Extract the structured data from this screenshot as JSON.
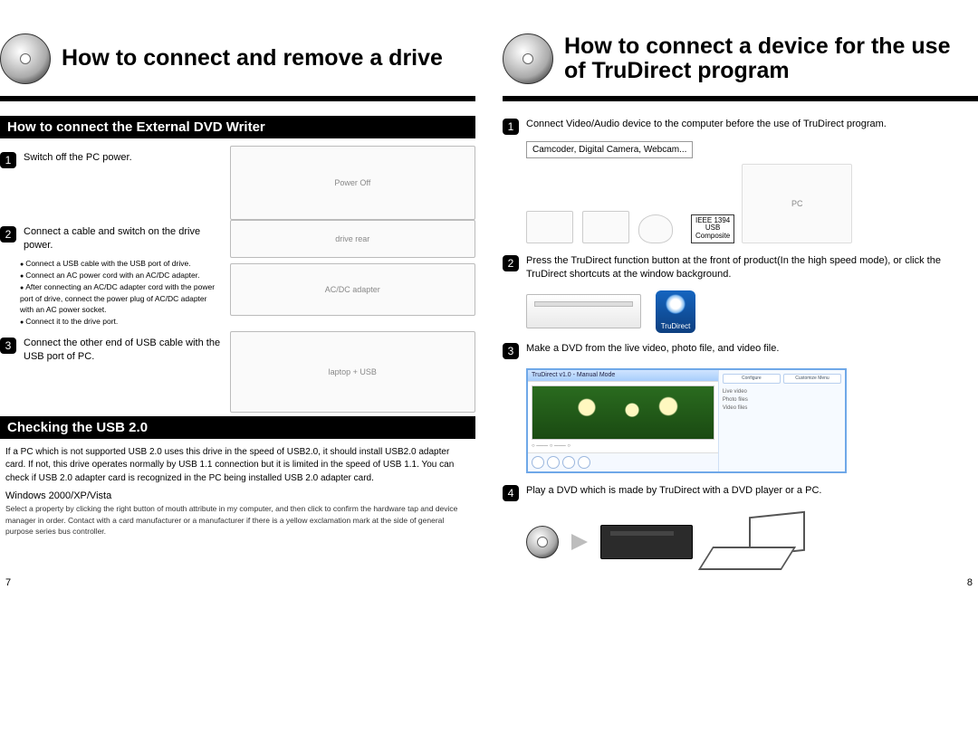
{
  "left": {
    "title": "How to connect and remove a drive",
    "section1_bar": "How to connect the External DVD Writer",
    "step1": "Switch off the PC power.",
    "illus1_badge": "Power Off",
    "step2": "Connect a cable and switch on the drive power.",
    "bullets2": [
      "Connect a USB cable with the USB port of drive.",
      "Connect an AC power cord with an AC/DC adapter.",
      "After connecting an AC/DC adapter cord with the power port of drive, connect the power plug of AC/DC adapter with an AC power socket.",
      "Connect it to the drive port."
    ],
    "step3": "Connect the other end of USB cable with the USB port of PC.",
    "section2_bar": "Checking the USB 2.0",
    "body1": "If a PC which is not supported USB 2.0 uses this drive in the speed of USB2.0, it should install USB2.0 adapter card. If not, this drive operates normally by USB 1.1 connection but it is limited in the speed of USB 1.1. You can check if USB 2.0 adapter card is recognized in the PC being installed USB 2.0 adapter card.",
    "subhead": "Windows 2000/XP/Vista",
    "body2": "Select a property by clicking the right button of mouth attribute in my computer, and then click to confirm the hardware tap and device manager in order. Contact with a card manufacturer or a manufacturer if there is a yellow exclamation mark at the side of general purpose series bus controller.",
    "pagenum": "7"
  },
  "right": {
    "title": "How to connect a device for the use of TruDirect program",
    "step1": "Connect Video/Audio device to the computer before the use of TruDirect program.",
    "devices_label": "Camcoder, Digital Camera, Webcam...",
    "conn_label": "IEEE 1394\nUSB\nComposite",
    "step2": "Press the TruDirect function button at the front of product(In the high speed mode), or click the TruDirect shortcuts at the window background.",
    "trudirect_label": "TruDirect",
    "step3": "Make a DVD from the live video, photo file, and video file.",
    "sshot_title": "TruDirect v1.0 - Manual Mode",
    "sshot_btns": [
      "Configure",
      "Customize Menu"
    ],
    "step4": "Play a DVD which is made by TruDirect with a DVD player or a PC.",
    "pagenum": "8"
  }
}
